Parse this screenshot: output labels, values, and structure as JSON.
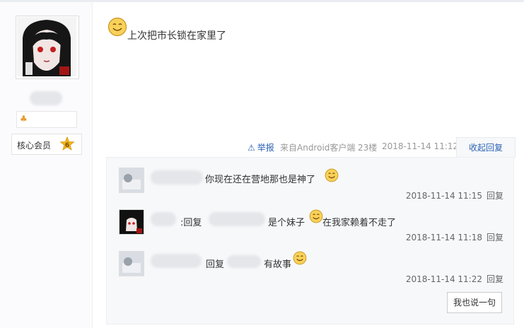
{
  "post": {
    "content": "上次把市长锁在家里了",
    "report_label": "举报",
    "source": "来自Android客户端",
    "floor": "23楼",
    "time": "2018-11-14 11:12",
    "collapse_label": "收起回复"
  },
  "author": {
    "member_label": "核心会员",
    "level": "6"
  },
  "replies": [
    {
      "text": "你现在还在营地那也是神了",
      "time": "2018-11-14 11:15",
      "reply_label": "回复"
    },
    {
      "prefix": ":回复",
      "text_a": "是个妹子",
      "text_b": "在我家赖着不走了",
      "time": "2018-11-14 11:18",
      "reply_label": "回复"
    },
    {
      "prefix": "回复",
      "text": "有故事",
      "time": "2018-11-14 11:22",
      "reply_label": "回复"
    }
  ],
  "say_button": "我也说一句",
  "colors": {
    "link": "#2d64b3",
    "badge": "#f2b51c"
  }
}
